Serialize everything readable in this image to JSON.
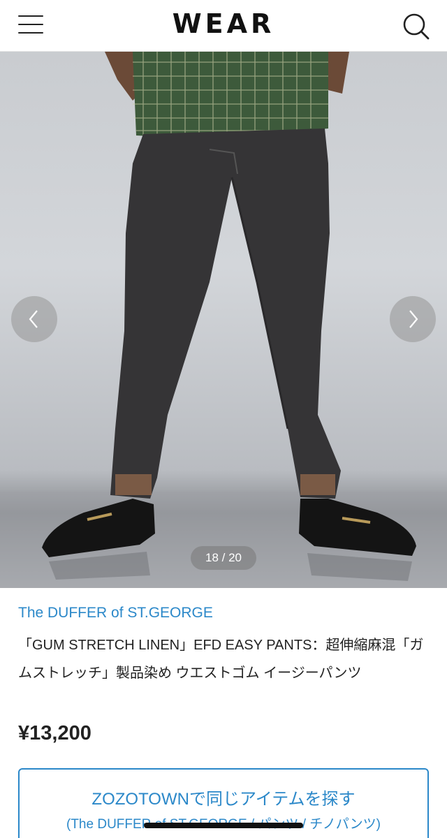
{
  "header": {
    "logo": "WEAR"
  },
  "gallery": {
    "counter": "18 / 20"
  },
  "item": {
    "brand": "The DUFFER of ST.GEORGE",
    "title": "「GUM STRETCH LINEN」EFD EASY PANTS：超伸縮麻混「ガムストレッチ」製品染め ウエストゴム イージーパンツ",
    "price": "¥13,200"
  },
  "zozo": {
    "label": "ZOZOTOWNで同じアイテムを探す",
    "sub": "(The DUFFER of ST.GEORGE / パンツ / チノパンツ)"
  },
  "colors": {
    "accent": "#2b88c9",
    "text": "#222222"
  },
  "icons": {
    "menu": "hamburger-icon",
    "search": "search-icon",
    "prev": "chevron-left-icon",
    "next": "chevron-right-icon"
  }
}
